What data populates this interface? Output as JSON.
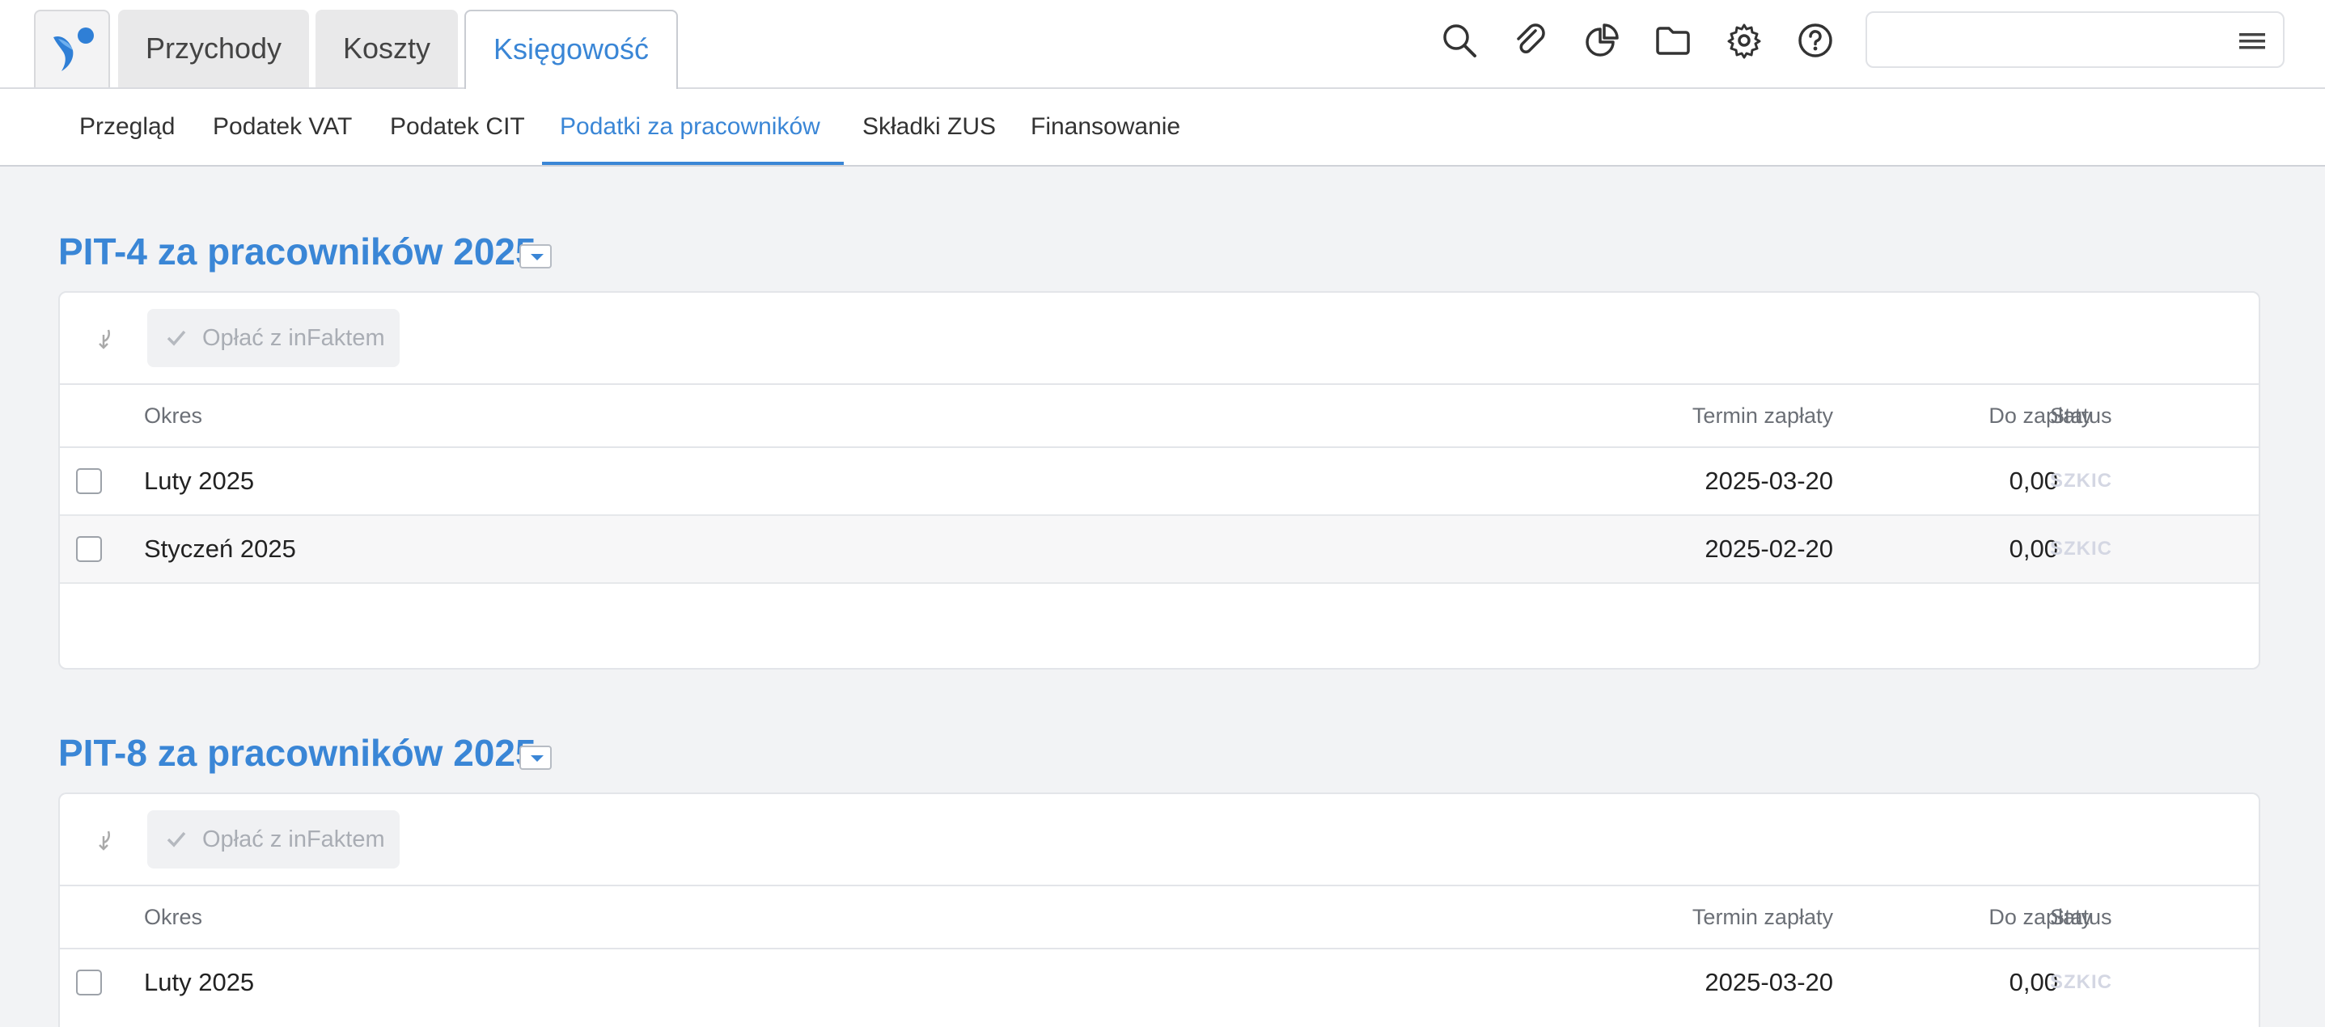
{
  "top_tabs": [
    {
      "label": "Przychody",
      "active": false
    },
    {
      "label": "Koszty",
      "active": false
    },
    {
      "label": "Księgowość",
      "active": true
    }
  ],
  "top_icons": [
    "search-icon",
    "paperclip-icon",
    "pie-chart-icon",
    "folder-icon",
    "gear-icon",
    "help-icon"
  ],
  "subnav": [
    {
      "label": "Przegląd",
      "active": false
    },
    {
      "label": "Podatek VAT",
      "active": false
    },
    {
      "label": "Podatek CIT",
      "active": false
    },
    {
      "label": "Podatki za pracowników",
      "active": true
    },
    {
      "label": "Składki ZUS",
      "active": false
    },
    {
      "label": "Finansowanie",
      "active": false
    }
  ],
  "colors": {
    "accent": "#3a86d6",
    "status_draft": "#d4d7e3"
  },
  "sections": [
    {
      "title": "PIT-4 za pracowników 2025",
      "pay_button": "Opłać z inFaktem",
      "columns": {
        "period": "Okres",
        "due_date": "Termin zapłaty",
        "amount": "Do zapłaty",
        "status": "Status"
      },
      "rows": [
        {
          "period": "Luty 2025",
          "due_date": "2025-03-20",
          "amount": "0,00",
          "status": "SZKIC"
        },
        {
          "period": "Styczeń 2025",
          "due_date": "2025-02-20",
          "amount": "0,00",
          "status": "SZKIC"
        }
      ]
    },
    {
      "title": "PIT-8 za pracowników 2025",
      "pay_button": "Opłać z inFaktem",
      "columns": {
        "period": "Okres",
        "due_date": "Termin zapłaty",
        "amount": "Do zapłaty",
        "status": "Status"
      },
      "rows": [
        {
          "period": "Luty 2025",
          "due_date": "2025-03-20",
          "amount": "0,00",
          "status": "SZKIC"
        }
      ]
    }
  ]
}
